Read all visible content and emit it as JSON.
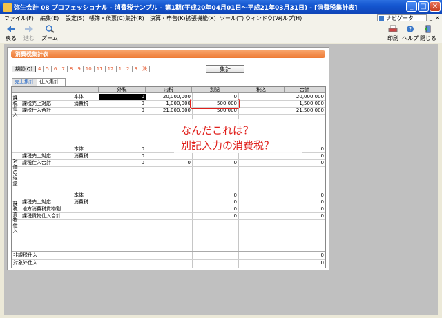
{
  "window": {
    "title": "弥生会計 08 プロフェッショナル - 消費税サンプル - 第1期(平成20年04月01日～平成21年03月31日) - [消費税集計表]",
    "min": "_",
    "max": "□",
    "close": "✕"
  },
  "menu": {
    "items": [
      "ファイル(F)",
      "編集(E)",
      "設定(S)",
      "帳簿・伝票(C)",
      "集計(R)",
      "決算・申告(K)",
      "拡張機能(X)",
      "ツール(T)",
      "ウィンドウ(W)",
      "ヘルプ(H)"
    ],
    "navi": "ナビゲータ",
    "mdi": [
      "_",
      "ƒ",
      "×"
    ]
  },
  "toolbar": {
    "back": "戻る",
    "forward": "進む",
    "zoom": "ズーム",
    "print": "印刷",
    "help": "ヘルプ",
    "close": "閉じる"
  },
  "panel": {
    "title": "消費税集計表",
    "period_main": "期間(Q)",
    "period_cells": [
      "4",
      "5",
      "6",
      "7",
      "8",
      "9",
      "10",
      "11",
      "12",
      "1",
      "2",
      "3",
      "決"
    ],
    "calc_button": "集計",
    "tabs": [
      "売上集計",
      "仕入集計"
    ]
  },
  "grid": {
    "headers": [
      "外税",
      "内税",
      "別記",
      "税込",
      "合計"
    ],
    "sections": {
      "kazei": "課税仕入",
      "taika": "対価の返還",
      "kamotsu": "課税貨物仕入"
    },
    "labels": {
      "r1": "課税売上対応",
      "r1a": "本体",
      "r1b": "消費税",
      "r2": "課税仕入合計",
      "r3": "課税売上対応",
      "r3a": "本体",
      "r3b": "消費税",
      "r4": "課税仕入合計",
      "r5": "課税売上対応",
      "r5a": "本体",
      "r5b": "消費税",
      "r6": "地方消費税貨物割",
      "r7": "課税貨物仕入合計",
      "r8": "非課税仕入",
      "r9": "対象外仕入"
    },
    "values": {
      "a1": "0",
      "a2": "20,000,000",
      "a3": "0",
      "a5": "20,000,000",
      "b1": "0",
      "b2": "1,000,000",
      "b3": "500,000",
      "b5": "1,500,000",
      "c1": "0",
      "c2": "21,000,000",
      "c3": "500,000",
      "c5": "21,500,000",
      "d1": "0",
      "d5": "0",
      "e1": "0",
      "e5": "0",
      "f1": "0",
      "f2": "0",
      "f3": "0",
      "f5": "0",
      "g3": "0",
      "g5": "0",
      "h3": "0",
      "h5": "0",
      "i3": "0",
      "i5": "0",
      "j3": "0",
      "j5": "0",
      "k5": "0",
      "l5": "0"
    }
  },
  "annotation": {
    "line1": "なんだこれは？",
    "line2": "別記入力の消費税？",
    "color": "#e0201c"
  }
}
